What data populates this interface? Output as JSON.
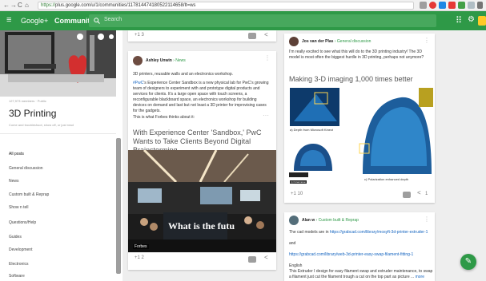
{
  "browser": {
    "url_scheme": "https://",
    "url_rest": "plus.google.com/u/1/communities/117814474180522114658/lt=ws",
    "nav_icons": [
      "←",
      "→",
      "C",
      "⌂",
      "🔒"
    ]
  },
  "appbar": {
    "menu_icon": "≡",
    "brand": "Google+",
    "section": "Communities",
    "search_placeholder": "Search",
    "apps_icon": "⠿",
    "settings_icon": "⚙"
  },
  "sidebar": {
    "members": "127,973 members · Public",
    "title": "3D Printing",
    "description": "Come and troubleshoot, show off, or just read",
    "items": [
      {
        "label": "All posts",
        "active": true
      },
      {
        "label": "General discussion"
      },
      {
        "label": "News"
      },
      {
        "label": "Custom built & Reprap"
      },
      {
        "label": "Show n tell"
      },
      {
        "label": "Questions/Help"
      },
      {
        "label": "Guides"
      },
      {
        "label": "Development"
      },
      {
        "label": "Electronics"
      },
      {
        "label": "Software"
      }
    ]
  },
  "post_mid_top": {
    "plus_count": "+1  3"
  },
  "post_mid": {
    "author": "Ashley Unwin",
    "community": "News",
    "line1": "3D printers, reusable walls and an electronics workshop.",
    "para_link": "#PwC",
    "para": "'s Experience Center Sandbox is a new physical lab for PwC's growing team of designers to experiment with and prototype digital products and services for clients. It's a large open space with touch screens, a reconfigurable blackboard space, an electronics workshop for building devices on demand and last but not least a 3D printer for improvising cases for the gadgets.",
    "line3": "This is what Forbes thinks about it:",
    "link_title": "With Experience Center 'Sandbox,' PwC Wants to Take Clients Beyond Digital Brainstorming",
    "photo_caption": "What is the futu",
    "photo_source": "Forbes",
    "plus_count": "+1  2"
  },
  "post_right": {
    "author": "Jos van der Plas",
    "community": "General discussion",
    "text": "I'm really excited to see what this will do to the 3D printing industry! The 3D model is most often the biggest hurdle in 3D printing, perhaps not anymore?",
    "link_title": "Making 3-D imaging 1,000 times better",
    "label_a": "a) Depth from Microsoft Kinect",
    "label_b": "b) Polarization",
    "label_c": "c) Polarization enhanced depth",
    "plus_count": "+1  10",
    "share_count": "1"
  },
  "post_right2": {
    "author": "Alan w",
    "community": "Custom built & Reprap",
    "line1_text": "The cad models are in ",
    "line1_link": "https://grabcad.com/library/mosyft-3d-printer-extruder-1",
    "line2": "and",
    "line3_link": "https://grabcad.com/library/web-3d-printer-easy-swap-filament-fitting-1",
    "line4": "English",
    "line5": "This Extruder I design for easy filament swap and extruder maintenance, to swap a filament just cut the filament trough a cut on the top part as picture ...",
    "more": "more"
  },
  "fab_icon": "✎"
}
